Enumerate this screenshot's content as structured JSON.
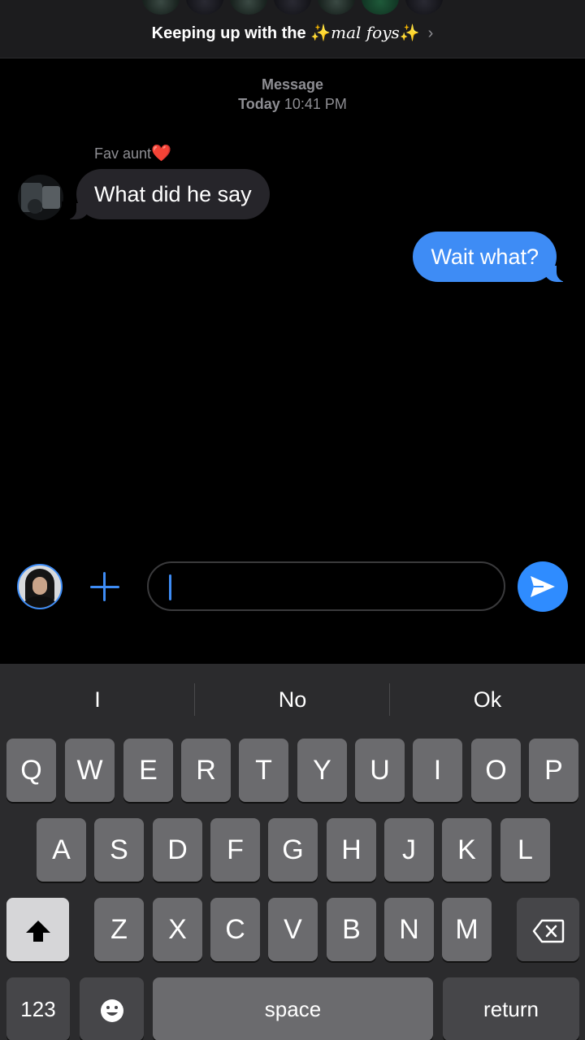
{
  "header": {
    "group_title_prefix": "Keeping up with the ✨",
    "group_title_styled": "mal foys",
    "group_title_suffix": "✨",
    "chevron": "›"
  },
  "conversation": {
    "service_label": "Message",
    "timestamp_day": "Today",
    "timestamp_time": "10:41 PM",
    "messages": [
      {
        "direction": "incoming",
        "sender": "Fav aunt",
        "sender_emoji": "❤️",
        "text": "What did he say"
      },
      {
        "direction": "outgoing",
        "text": "Wait what?"
      }
    ]
  },
  "composer": {
    "input_value": "",
    "input_placeholder": ""
  },
  "keyboard": {
    "suggestions": [
      "I",
      "No",
      "Ok"
    ],
    "row1": [
      "Q",
      "W",
      "E",
      "R",
      "T",
      "Y",
      "U",
      "I",
      "O",
      "P"
    ],
    "row2": [
      "A",
      "S",
      "D",
      "F",
      "G",
      "H",
      "J",
      "K",
      "L"
    ],
    "row3": [
      "Z",
      "X",
      "C",
      "V",
      "B",
      "N",
      "M"
    ],
    "numbers_label": "123",
    "space_label": "space",
    "return_label": "return"
  },
  "colors": {
    "accent": "#3e8cf5",
    "incoming_bubble": "#26252a",
    "outgoing_bubble": "#3e8cf5",
    "background": "#000000",
    "keyboard_bg": "#2b2b2d"
  },
  "icons": [
    "chevron-right-icon",
    "heart-icon",
    "plus-icon",
    "send-arrow-icon",
    "shift-arrow-icon",
    "backspace-icon",
    "emoji-icon"
  ]
}
